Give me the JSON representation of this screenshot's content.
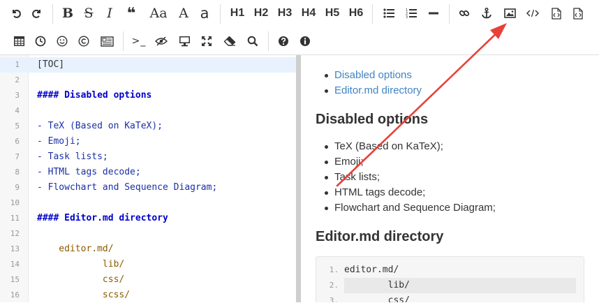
{
  "toolbar": {
    "row1": {
      "undo": "undo-icon",
      "redo": "redo-icon",
      "bold_label": "B",
      "strike_label": "S",
      "italic_label": "I",
      "quote_label": "❝",
      "uppercase_label": "Aa",
      "ucwords_label": "A",
      "lowercase_label": "a",
      "h1": "H1",
      "h2": "H2",
      "h3": "H3",
      "h4": "H4",
      "h5": "H5",
      "h6": "H6"
    },
    "row2": {
      "table": "table-icon",
      "datetime": "clock-icon",
      "emoji": "smiley-icon",
      "html_entities": "copyright-icon",
      "pagebreak": "pagebreak-icon",
      "code_label": ">_",
      "preview": "eye-icon",
      "watch": "monitor-icon",
      "fullscreen": "fullscreen-icon",
      "clear": "eraser-icon",
      "search": "search-icon",
      "help": "help-icon",
      "info": "info-icon"
    }
  },
  "editor": {
    "lines": [
      {
        "n": "1",
        "text": "[TOC]"
      },
      {
        "n": "2",
        "text": ""
      },
      {
        "n": "3",
        "text": "#### Disabled options"
      },
      {
        "n": "4",
        "text": ""
      },
      {
        "n": "5",
        "text": "- TeX (Based on KaTeX);"
      },
      {
        "n": "6",
        "text": "- Emoji;"
      },
      {
        "n": "7",
        "text": "- Task lists;"
      },
      {
        "n": "8",
        "text": "- HTML tags decode;"
      },
      {
        "n": "9",
        "text": "- Flowchart and Sequence Diagram;"
      },
      {
        "n": "10",
        "text": ""
      },
      {
        "n": "11",
        "text": "#### Editor.md directory"
      },
      {
        "n": "12",
        "text": ""
      },
      {
        "n": "13",
        "text": "    editor.md/"
      },
      {
        "n": "14",
        "text": "            lib/"
      },
      {
        "n": "15",
        "text": "            css/"
      },
      {
        "n": "16",
        "text": "            scss/"
      }
    ]
  },
  "preview": {
    "toc": [
      "Disabled options",
      "Editor.md directory"
    ],
    "h_disabled": "Disabled options",
    "disabled_items": [
      "TeX (Based on KaTeX);",
      "Emoji;",
      "Task lists;",
      "HTML tags decode;",
      "Flowchart and Sequence Diagram;"
    ],
    "h_directory": "Editor.md directory",
    "code_lines": [
      {
        "n": "1.",
        "text": "editor.md/"
      },
      {
        "n": "2.",
        "text": "        lib/"
      },
      {
        "n": "3.",
        "text": "        css/"
      }
    ]
  },
  "colors": {
    "link": "#4183c4",
    "arrow": "#e8403a",
    "header_code": "#0000cc",
    "list_code": "#1a2fa5",
    "indent_code": "#8a5a00"
  }
}
